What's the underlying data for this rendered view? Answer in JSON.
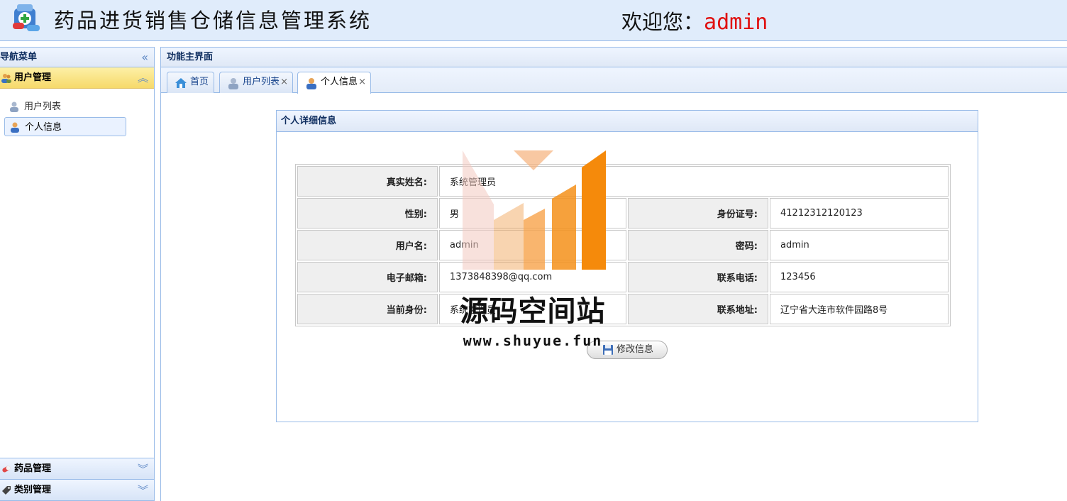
{
  "header": {
    "app_title": "药品进货销售仓储信息管理系统",
    "welcome_prefix": "欢迎您：",
    "username": "admin"
  },
  "nav": {
    "title": "导航菜单",
    "sections": [
      {
        "label": "用户管理",
        "state": "expanded",
        "items": [
          {
            "label": "用户列表",
            "selected": false
          },
          {
            "label": "个人信息",
            "selected": true
          }
        ]
      },
      {
        "label": "药品管理",
        "state": "collapsed"
      },
      {
        "label": "类别管理",
        "state": "collapsed"
      }
    ]
  },
  "main": {
    "title": "功能主界面",
    "tabs": [
      {
        "label": "首页",
        "closable": false,
        "active": false
      },
      {
        "label": "用户列表",
        "closable": true,
        "active": false
      },
      {
        "label": "个人信息",
        "closable": true,
        "active": true
      }
    ],
    "tab_close": "×"
  },
  "profile": {
    "title": "个人详细信息",
    "real_name_label": "真实姓名:",
    "real_name": "系统管理员",
    "gender_label": "性别:",
    "gender": "男",
    "id_label": "身份证号:",
    "id_number": "41212312120123",
    "username_label": "用户名:",
    "username": "admin",
    "password_label": "密码:",
    "password": "admin",
    "email_label": "电子邮箱:",
    "email": "1373848398@qq.com",
    "phone_label": "联系电话:",
    "phone": "123456",
    "role_label": "当前身份:",
    "role": "系统管理员",
    "address_label": "联系地址:",
    "address": "辽宁省大连市软件园路8号",
    "edit_button": "修改信息"
  },
  "watermark": {
    "name": "源码空间站",
    "url": "www.shuyue.fun"
  },
  "colors": {
    "header_bg": "#e0ecfb",
    "border": "#99bbe8",
    "active_section": "#f6d96a",
    "username_red": "#e01010",
    "watermark_orange": "#f58a0b"
  }
}
